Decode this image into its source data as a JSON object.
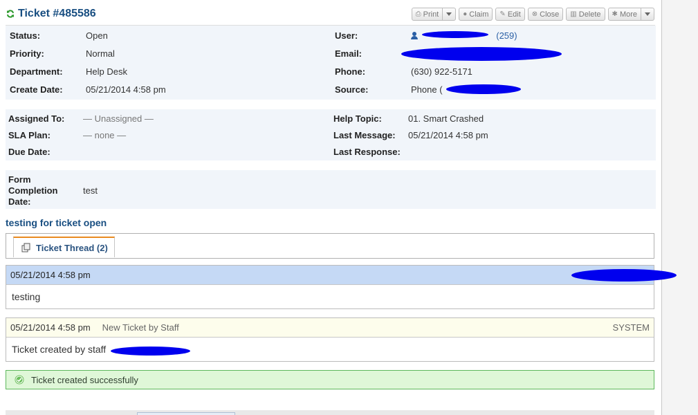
{
  "ticket": {
    "title": "Ticket #485586"
  },
  "toolbar": {
    "print": "Print",
    "claim": "Claim",
    "edit": "Edit",
    "close": "Close",
    "delete": "Delete",
    "more": "More"
  },
  "info": {
    "status_label": "Status:",
    "status": "Open",
    "priority_label": "Priority:",
    "priority": "Normal",
    "department_label": "Department:",
    "department": "Help Desk",
    "create_date_label": "Create Date:",
    "create_date": "05/21/2014 4:58 pm",
    "user_label": "User:",
    "user_count": "(259)",
    "email_label": "Email:",
    "phone_label": "Phone:",
    "phone": "(630) 922-5171",
    "source_label": "Source:",
    "source": "Phone ("
  },
  "assignment": {
    "assigned_label": "Assigned To:",
    "assigned": "— Unassigned —",
    "sla_label": "SLA Plan:",
    "sla": "— none —",
    "due_label": "Due Date:",
    "topic_label": "Help Topic:",
    "topic": "01. Smart Crashed",
    "last_message_label": "Last Message:",
    "last_message": "05/21/2014 4:58 pm",
    "last_response_label": "Last Response:"
  },
  "form": {
    "label_1": "Form",
    "label_2": "Completion",
    "label_3": "Date:",
    "value": "test"
  },
  "subject": "testing for ticket open",
  "tabs": {
    "thread": "Ticket Thread (2)"
  },
  "thread": [
    {
      "date": "05/21/2014 4:58 pm",
      "body": "testing"
    },
    {
      "date": "05/21/2014 4:58 pm",
      "desc": "New Ticket by Staff",
      "poster": "SYSTEM",
      "body": "Ticket created by staff"
    }
  ],
  "notice": "Ticket created successfully",
  "colors": {
    "heading": "#184e81",
    "link": "#2a5fa5",
    "tab_accent": "#e98a1f",
    "success_bg": "#dff7d8",
    "redaction": "#0000ee"
  }
}
